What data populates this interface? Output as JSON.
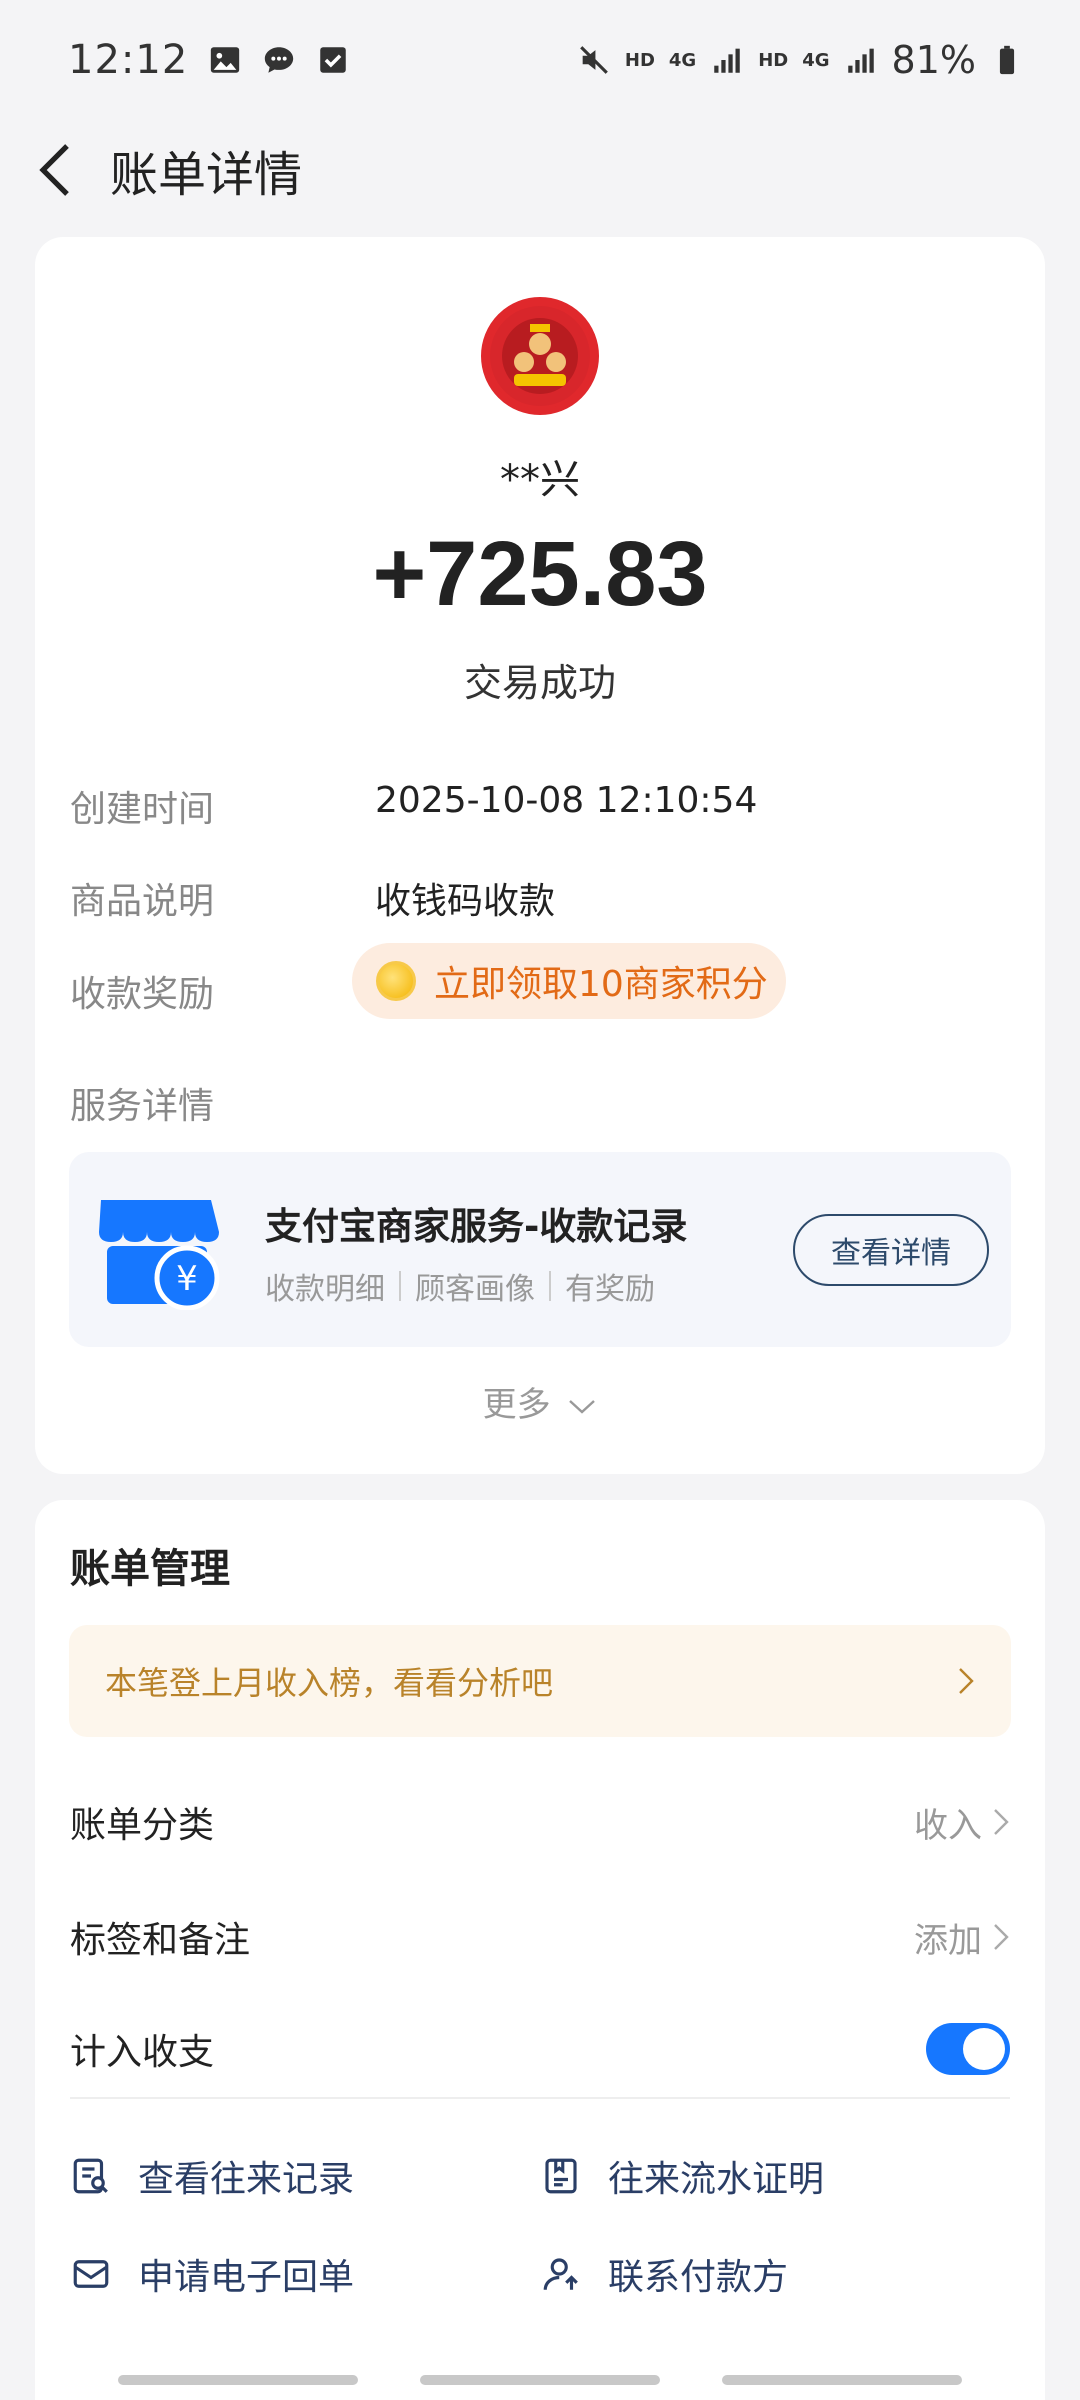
{
  "status_bar": {
    "time": "12:12",
    "hd1": "HD",
    "net1": "4G",
    "hd2": "HD",
    "net2": "4G",
    "battery": "81%"
  },
  "header": {
    "title": "账单详情"
  },
  "transaction": {
    "name": "**兴",
    "amount": "+725.83",
    "status": "交易成功"
  },
  "details": {
    "created_label": "创建时间",
    "created_value": "2025-10-08 12:10:54",
    "product_label": "商品说明",
    "product_value": "收钱码收款",
    "reward_label": "收款奖励",
    "reward_value": "立即领取10商家积分",
    "service_label": "服务详情"
  },
  "service": {
    "title": "支付宝商家服务-收款记录",
    "tags": [
      "收款明细",
      "顾客画像",
      "有奖励"
    ],
    "button": "查看详情"
  },
  "more_label": "更多",
  "management": {
    "title": "账单管理",
    "banner": "本笔登上月收入榜，看看分析吧",
    "category_label": "账单分类",
    "category_value": "收入",
    "tags_label": "标签和备注",
    "tags_value": "添加",
    "count_label": "计入收支",
    "count_enabled": true,
    "actions": [
      "查看往来记录",
      "往来流水证明",
      "申请电子回单",
      "联系付款方"
    ]
  },
  "colors": {
    "accent": "#1677ff",
    "reward": "#e26a16",
    "banner_text": "#b9832a"
  }
}
